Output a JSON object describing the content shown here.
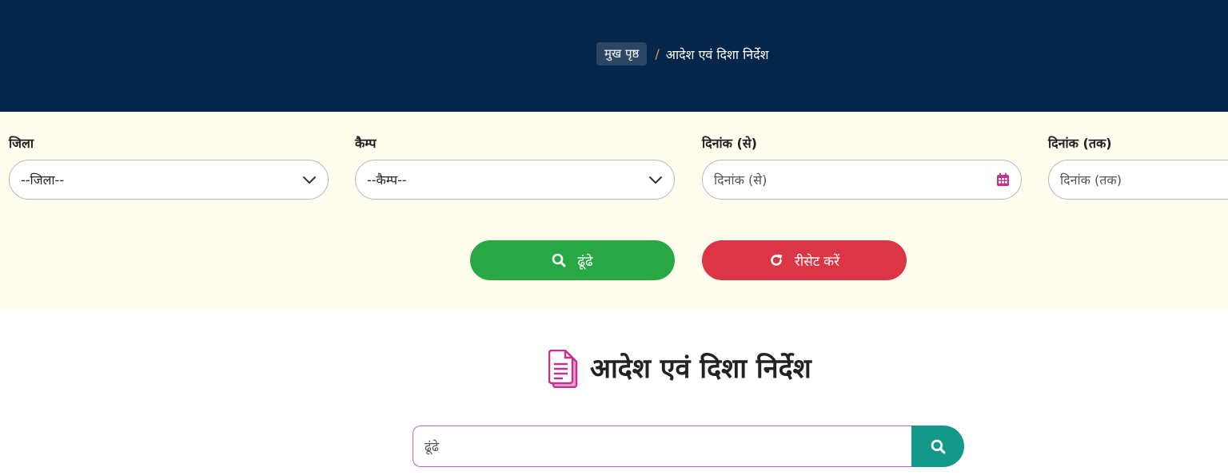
{
  "breadcrumb": {
    "home": "मुख पृष्ठ",
    "separator": "/",
    "current": "आदेश एवं दिशा निर्देश"
  },
  "filters": {
    "district": {
      "label": "जिला",
      "selected": "--जिला--",
      "icon": "chevron-down-icon"
    },
    "camp": {
      "label": "कैम्प",
      "selected": "--कैम्प--",
      "icon": "chevron-down-icon"
    },
    "date_from": {
      "label": "दिनांक (से)",
      "placeholder": "दिनांक (से)",
      "icon": "calendar-icon"
    },
    "date_to": {
      "label": "दिनांक (तक)",
      "placeholder": "दिनांक (तक)"
    }
  },
  "buttons": {
    "search": {
      "label": "ढूंढे",
      "icon": "search-icon",
      "color": "#28a745"
    },
    "reset": {
      "label": "रीसेट करें",
      "icon": "refresh-icon",
      "color": "#dc3545"
    }
  },
  "section": {
    "title": "आदेश एवं दिशा निर्देश",
    "icon": "documents-icon"
  },
  "search": {
    "placeholder": "ढूंढे",
    "button_icon": "search-icon"
  },
  "colors": {
    "header_bg": "#03264a",
    "filter_bg": "#fffdee",
    "accent_pink": "#c2328f",
    "teal": "#12998a"
  }
}
